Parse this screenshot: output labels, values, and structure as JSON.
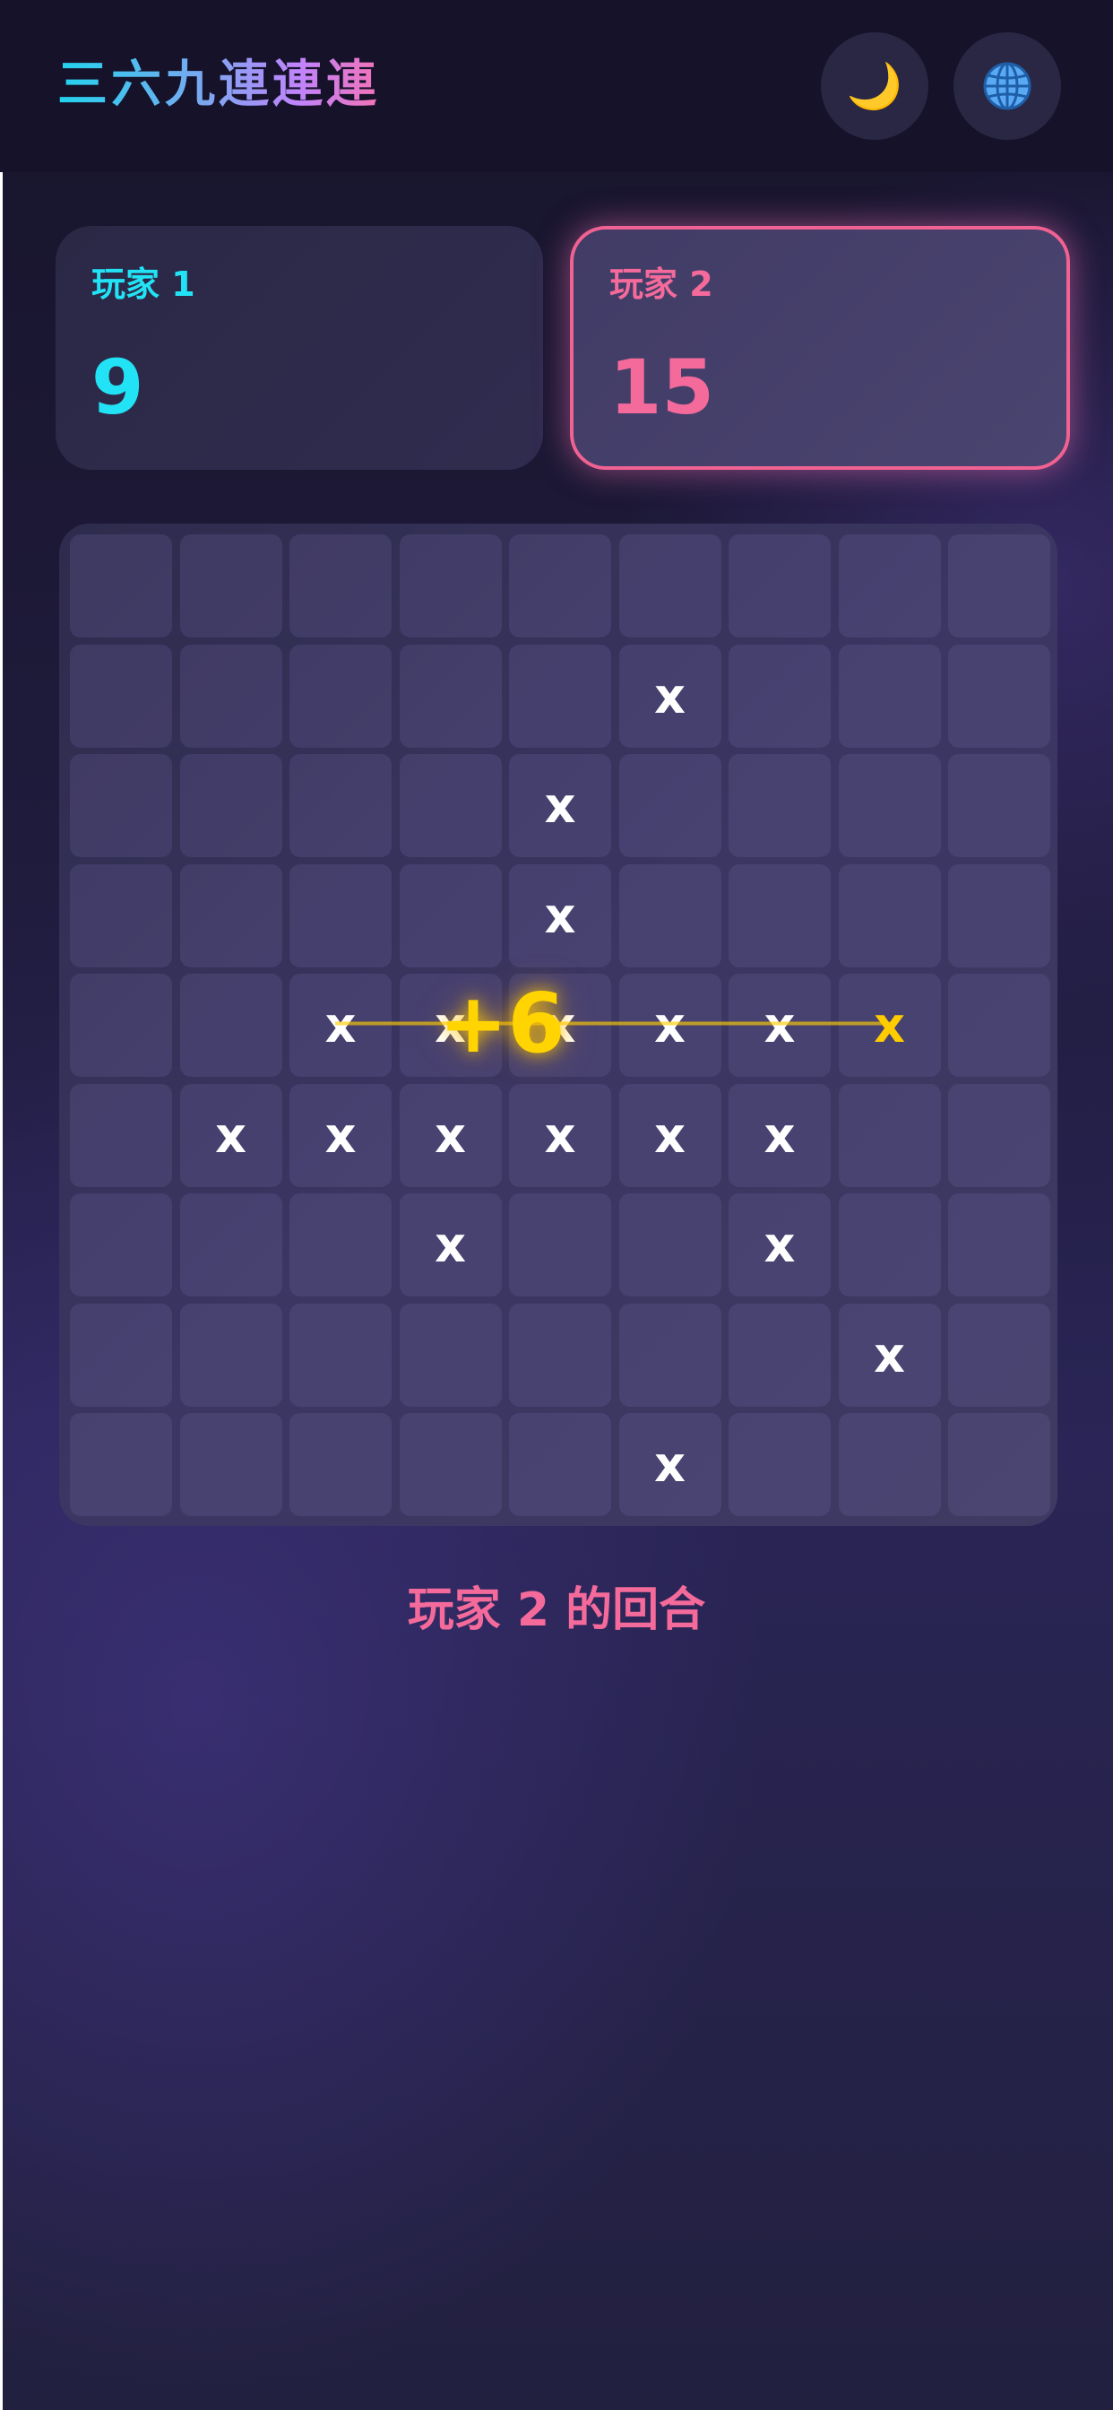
{
  "header": {
    "title": "三六九連連連",
    "theme_button": {
      "icon": "moon-icon",
      "glyph": "🌙"
    },
    "language_button": {
      "icon": "globe-icon",
      "glyph": "🌐"
    }
  },
  "players": [
    {
      "label": "玩家 1",
      "score": "9",
      "color": "#22e3f5",
      "active": false
    },
    {
      "label": "玩家 2",
      "score": "15",
      "color": "#f46a9b",
      "active": true
    }
  ],
  "board": {
    "size": 9,
    "rows": [
      [
        "",
        "",
        "",
        "",
        "",
        "",
        "",
        "",
        ""
      ],
      [
        "",
        "",
        "",
        "",
        "",
        "x",
        "",
        "",
        ""
      ],
      [
        "",
        "",
        "",
        "",
        "x",
        "",
        "",
        "",
        ""
      ],
      [
        "",
        "",
        "",
        "",
        "x",
        "",
        "",
        "",
        ""
      ],
      [
        "",
        "",
        "x",
        "x",
        "x",
        "x",
        "x",
        "x",
        ""
      ],
      [
        "",
        "x",
        "x",
        "x",
        "x",
        "x",
        "x",
        "",
        ""
      ],
      [
        "",
        "",
        "",
        "x",
        "",
        "",
        "x",
        "",
        ""
      ],
      [
        "",
        "",
        "",
        "",
        "",
        "",
        "",
        "x",
        ""
      ],
      [
        "",
        "",
        "",
        "",
        "",
        "x",
        "",
        "",
        ""
      ]
    ],
    "last_move": {
      "row": 4,
      "col": 7
    },
    "scored_line": {
      "row": 4,
      "from_col": 2,
      "to_col": 7
    },
    "points_popup": "+6",
    "highlight_color": "#ffcc00"
  },
  "status": {
    "turn_text": "玩家 2 的回合"
  }
}
